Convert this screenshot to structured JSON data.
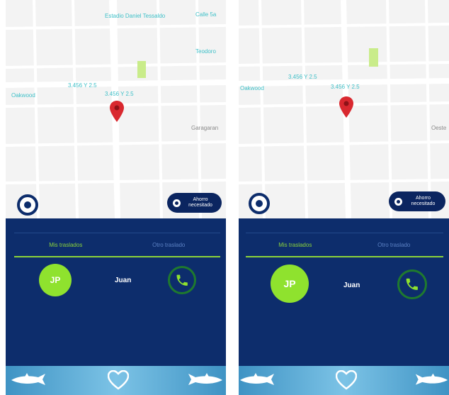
{
  "screens": [
    {
      "map": {
        "labels": [
          "Estadio Daniel Tessaldo",
          "Calle 5a",
          "Teodoro",
          "3.456 Y 2.5",
          "3.456 Y 2.5",
          "Oakwood",
          "Garagaran"
        ],
        "pin_color": "#d9282f",
        "button_text": "Ahorro necesitado"
      },
      "tabs": [
        "Mis traslados",
        "Otro traslado"
      ],
      "active_tab": 0,
      "contact": {
        "initials": "JP",
        "name": "Juan"
      }
    },
    {
      "map": {
        "labels": [
          "3.456 Y 2.5",
          "3.456 Y 2.5",
          "Oakwood",
          "Oeste"
        ],
        "pin_color": "#d9282f",
        "button_text": "Ahorro necesitado"
      },
      "tabs": [
        "Mis traslados",
        "Otro traslado"
      ],
      "active_tab": 0,
      "contact": {
        "initials": "JP",
        "name": "Juan"
      }
    }
  ],
  "colors": {
    "navy": "#0d2d6c",
    "green": "#8fe22e",
    "tab_active": "#8bd33a",
    "tab_inactive": "#5c82c4",
    "map_label": "#3fc0c8"
  },
  "icons": {
    "footer": [
      "tiburon-icon",
      "heart-icon",
      "tiburon-icon"
    ],
    "call": "phone-icon",
    "locate": "locate-icon",
    "pin": "map-pin-icon"
  }
}
